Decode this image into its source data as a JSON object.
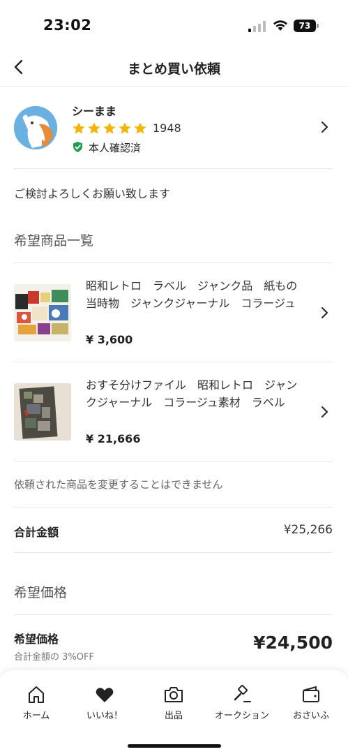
{
  "status_bar": {
    "time": "23:02",
    "battery": "73"
  },
  "nav": {
    "title": "まとめ買い依頼"
  },
  "seller": {
    "name": "シーまま",
    "rating_count": "1948",
    "stars": 5,
    "verified": "本人確認済"
  },
  "message": "ご検討よろしくお願い致します",
  "items_section": {
    "title": "希望商品一覧",
    "items": [
      {
        "title": "昭和レトロ　ラベル　ジャンク品　紙もの　当時物　ジャンクジャーナル　コラージュ",
        "price": "¥ 3,600"
      },
      {
        "title": "おすそ分けファイル　昭和レトロ　ジャンクジャーナル　コラージュ素材　ラベル",
        "price": "¥ 21,666"
      }
    ]
  },
  "note": "依頼された商品を変更することはできません",
  "total": {
    "label": "合計金額",
    "value": "¥25,266"
  },
  "desired_section": {
    "title": "希望価格"
  },
  "desired_price": {
    "label": "希望価格",
    "sub": "合計金額の 3%OFF",
    "value": "¥24,500"
  },
  "tabs": [
    {
      "label": "ホーム",
      "icon": "home-icon"
    },
    {
      "label": "いいね！",
      "icon": "heart-icon"
    },
    {
      "label": "出品",
      "icon": "camera-icon"
    },
    {
      "label": "オークション",
      "icon": "gavel-icon"
    },
    {
      "label": "おさいふ",
      "icon": "wallet-icon"
    }
  ],
  "colors": {
    "star": "#f5b400",
    "verified": "#1f9d55",
    "text": "#222222"
  }
}
